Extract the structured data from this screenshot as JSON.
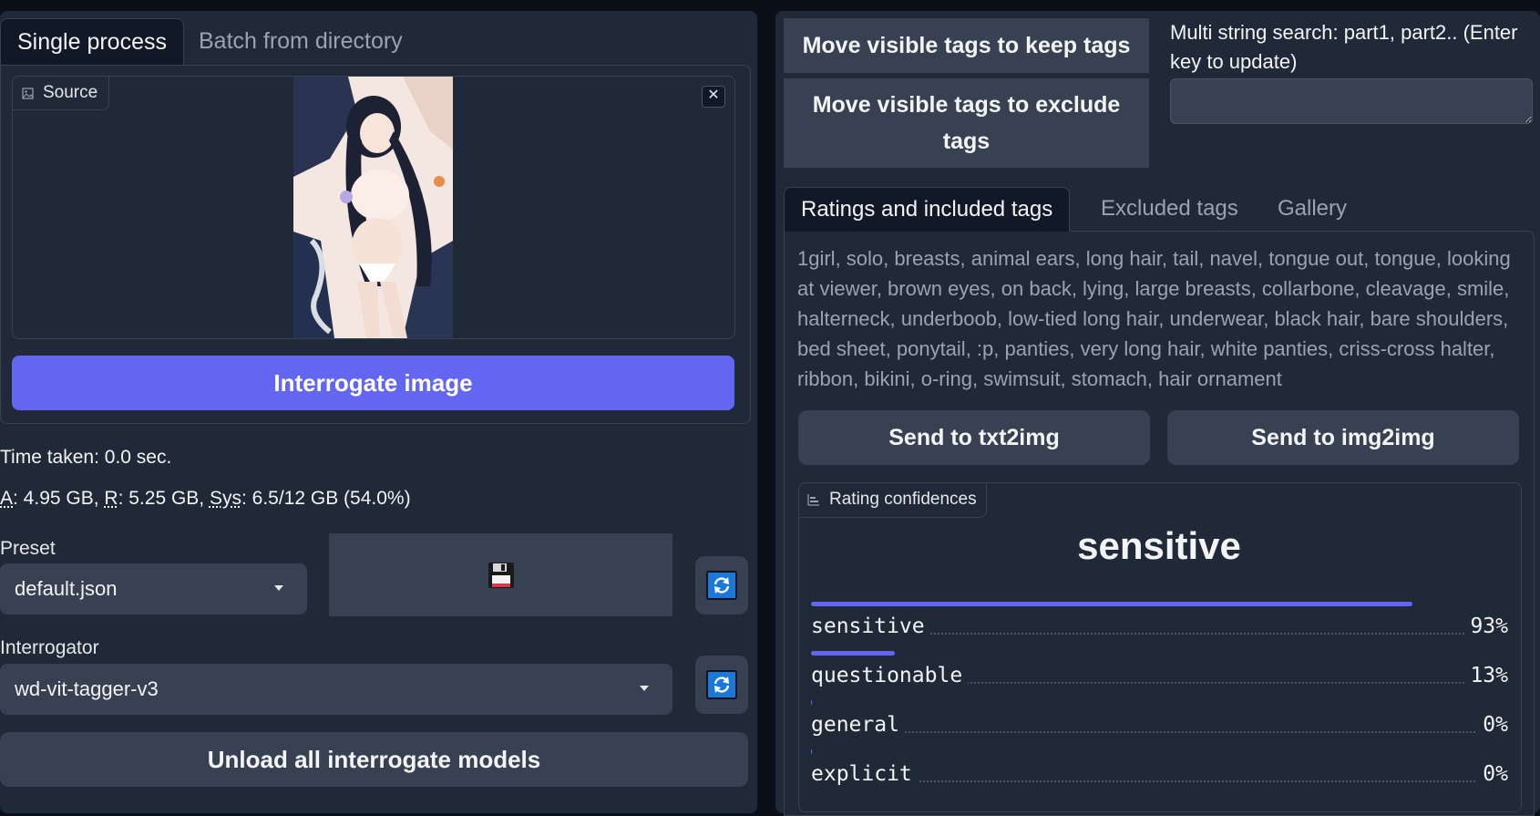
{
  "left": {
    "tabs": [
      "Single process",
      "Batch from directory"
    ],
    "source_label": "Source",
    "close_glyph": "✕",
    "interrogate_label": "Interrogate image",
    "time_taken": "Time taken: 0.0 sec.",
    "memory": {
      "a_key": "A",
      "a_val": ": 4.95 GB, ",
      "r_key": "R",
      "r_val": ": 5.25 GB, ",
      "sys_key": "Sys",
      "sys_val": ": 6.5/12 GB (54.0%)"
    },
    "preset_label": "Preset",
    "preset_value": "default.json",
    "interrogator_label": "Interrogator",
    "interrogator_value": "wd-vit-tagger-v3",
    "unload_label": "Unload all interrogate models"
  },
  "right": {
    "move_keep_label": "Move visible tags to keep tags",
    "move_exclude_label": "Move visible tags to exclude tags",
    "search_label": "Multi string search: part1, part2.. (Enter key to update)",
    "search_value": "",
    "tabs": [
      "Ratings and included tags",
      "Excluded tags",
      "Gallery"
    ],
    "tags_text": "1girl, solo, breasts, animal ears, long hair, tail, navel, tongue out, tongue, looking at viewer, brown eyes, on back, lying, large breasts, collarbone, cleavage, smile, halterneck, underboob, low-tied long hair, underwear, black hair, bare shoulders, bed sheet, ponytail, :p, panties, very long hair, white panties, criss-cross halter, ribbon, bikini, o-ring, swimsuit, stomach, hair ornament",
    "send_txt2img": "Send to txt2img",
    "send_img2img": "Send to img2img",
    "confidence_label": "Rating confidences",
    "top_rating": "sensitive",
    "ratings": [
      {
        "name": "sensitive",
        "percent": "93%",
        "value": 0.93
      },
      {
        "name": "questionable",
        "percent": "13%",
        "value": 0.13
      },
      {
        "name": "general",
        "percent": "0%",
        "value": 0.0
      },
      {
        "name": "explicit",
        "percent": "0%",
        "value": 0.0
      }
    ]
  },
  "colors": {
    "accent": "#6366f1",
    "panel": "#1f2937",
    "background": "#0b0f19",
    "button": "#374151"
  },
  "icons": {
    "image": "image-icon",
    "save": "floppy-disk-icon",
    "refresh": "refresh-icon",
    "chart": "bar-chart-icon",
    "close": "close-icon",
    "caret": "chevron-down-icon"
  }
}
